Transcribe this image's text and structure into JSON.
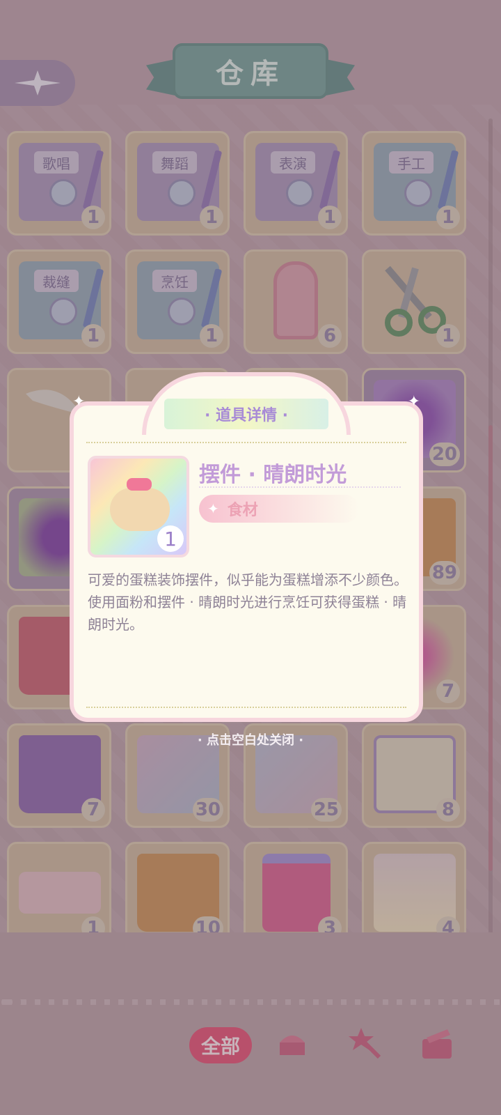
{
  "header": {
    "title": "仓库",
    "back_icon": "compass-star-icon"
  },
  "grid": {
    "items": [
      {
        "label": "歌唱",
        "count": "1",
        "kind": "book"
      },
      {
        "label": "舞蹈",
        "count": "1",
        "kind": "book"
      },
      {
        "label": "表演",
        "count": "1",
        "kind": "book"
      },
      {
        "label": "手工",
        "count": "1",
        "kind": "book"
      },
      {
        "label": "裁缝",
        "count": "1",
        "kind": "book"
      },
      {
        "label": "烹饪",
        "count": "1",
        "kind": "book"
      },
      {
        "label": "",
        "count": "6",
        "kind": "mirror"
      },
      {
        "label": "",
        "count": "1",
        "kind": "scissors"
      },
      {
        "label": "",
        "count": "",
        "kind": "feather"
      },
      {
        "label": "",
        "count": "",
        "kind": "hidden"
      },
      {
        "label": "",
        "count": "",
        "kind": "hidden"
      },
      {
        "label": "",
        "count": "20",
        "kind": "sparkle-purple"
      },
      {
        "label": "",
        "count": "",
        "kind": "sparkle-purple"
      },
      {
        "label": "",
        "count": "",
        "kind": "hidden"
      },
      {
        "label": "",
        "count": "",
        "kind": "hidden"
      },
      {
        "label": "",
        "count": "89",
        "kind": "grocery-orange"
      },
      {
        "label": "",
        "count": "",
        "kind": "grocery-red"
      },
      {
        "label": "",
        "count": "",
        "kind": "hidden"
      },
      {
        "label": "",
        "count": "",
        "kind": "hidden"
      },
      {
        "label": "",
        "count": "7",
        "kind": "pink-gem"
      },
      {
        "label": "",
        "count": "7",
        "kind": "grocery-purple"
      },
      {
        "label": "",
        "count": "30",
        "kind": "photos"
      },
      {
        "label": "",
        "count": "25",
        "kind": "photos"
      },
      {
        "label": "",
        "count": "8",
        "kind": "scroll"
      },
      {
        "label": "",
        "count": "1",
        "kind": "ticket"
      },
      {
        "label": "",
        "count": "10",
        "kind": "grocery-orange"
      },
      {
        "label": "",
        "count": "3",
        "kind": "giftbox"
      },
      {
        "label": "",
        "count": "4",
        "kind": "comic"
      }
    ]
  },
  "dialog": {
    "header": "· 道具详情 ·",
    "item_name": "摆件 · 晴朗时光",
    "item_count": "1",
    "tag": "食材",
    "desc_line1": "可爱的蛋糕装饰摆件，似乎能为蛋糕增添不少颜色。",
    "desc_line2": "使用面粉和摆件 · 晴朗时光进行烹饪可获得蛋糕 · 晴朗时光。",
    "close_hint": "· 点击空白处关闭 ·"
  },
  "bottom_tabs": {
    "all_label": "全部",
    "icons": [
      "cake-icon",
      "magic-wand-icon",
      "gift-box-icon"
    ]
  },
  "colors": {
    "accent": "#e0496f",
    "dialog_title": "#c29bd8",
    "tag_text": "#eca2b4"
  }
}
